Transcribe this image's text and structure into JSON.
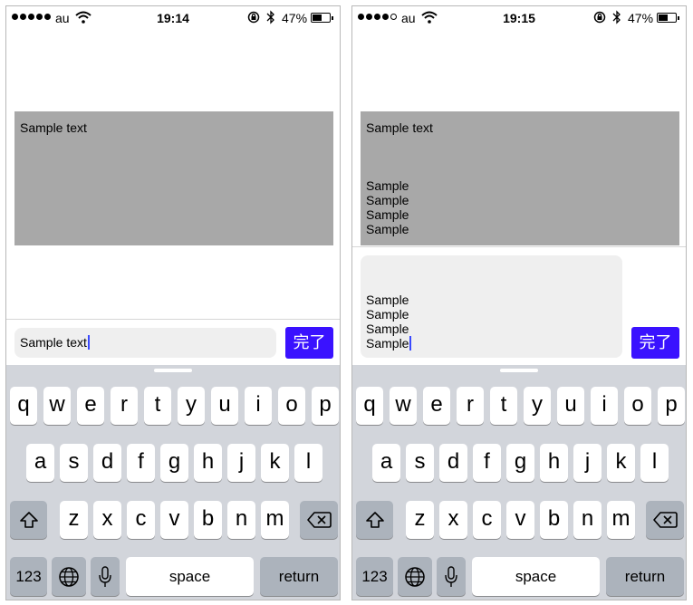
{
  "screens": [
    {
      "status": {
        "carrier": "au",
        "time": "19:14",
        "battery": "47%"
      },
      "display_lines": [
        "Sample text"
      ],
      "input_lines": [
        "Sample text"
      ],
      "done_label": "完了"
    },
    {
      "status": {
        "carrier": "au",
        "time": "19:15",
        "battery": "47%"
      },
      "display_lines": [
        "Sample text",
        "",
        "",
        "",
        "Sample",
        "Sample",
        "Sample",
        "Sample"
      ],
      "input_lines": [
        "Sample",
        "Sample",
        "Sample",
        "Sample"
      ],
      "done_label": "完了"
    }
  ],
  "keyboard": {
    "row1": [
      "q",
      "w",
      "e",
      "r",
      "t",
      "y",
      "u",
      "i",
      "o",
      "p"
    ],
    "row2": [
      "a",
      "s",
      "d",
      "f",
      "g",
      "h",
      "j",
      "k",
      "l"
    ],
    "row3": [
      "z",
      "x",
      "c",
      "v",
      "b",
      "n",
      "m"
    ],
    "numbers_label": "123",
    "space_label": "space",
    "return_label": "return"
  },
  "icons": {
    "signal": "signal-dots-icon",
    "wifi": "wifi-icon",
    "orientation_lock": "rotation-lock-icon",
    "bluetooth": "bluetooth-icon",
    "battery": "battery-icon",
    "shift": "shift-icon",
    "delete": "backspace-icon",
    "globe": "globe-icon",
    "mic": "microphone-icon"
  },
  "colors": {
    "accent": "#3a12ff",
    "caret": "#3a49ff",
    "display_bg": "#a8a8a8",
    "input_bg": "#efefef",
    "keyboard_bg": "#d2d5db"
  }
}
